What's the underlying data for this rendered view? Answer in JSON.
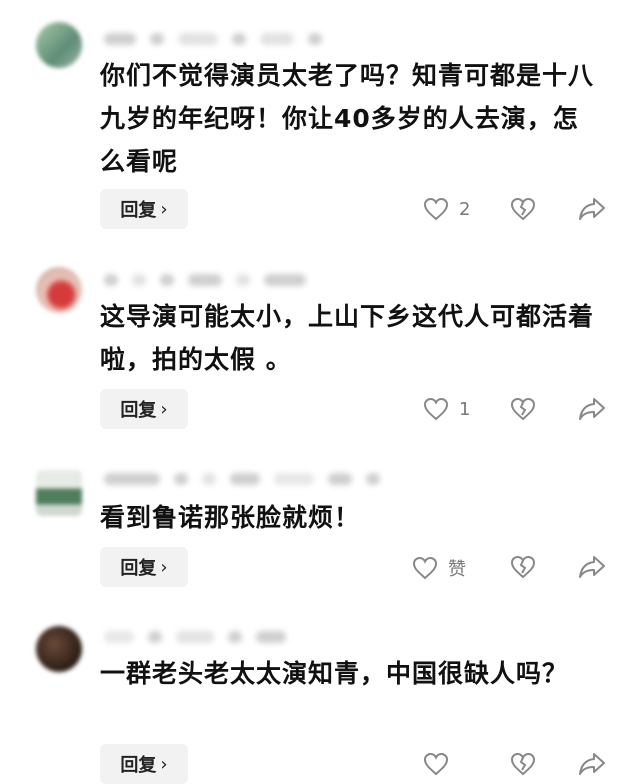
{
  "comments": [
    {
      "text": "你们不觉得演员太老了吗？知青可都是十八九岁的年纪呀！你让40多岁的人去演，怎么看呢",
      "reply_label": "回复",
      "like_count": "2",
      "avatar_color": "#6f9c7e"
    },
    {
      "text": "这导演可能太小，上山下乡这代人可都活着啦，拍的太假 。",
      "reply_label": "回复",
      "like_count": "1",
      "avatar_color": "#c23a3a"
    },
    {
      "text": "看到鲁诺那张脸就烦！",
      "reply_label": "回复",
      "like_count": "赞",
      "avatar_color": "#4d7a5c"
    },
    {
      "text": "一群老头老太太演知青，中国很缺人吗？",
      "reply_label": "回复",
      "like_count": "",
      "avatar_color": "#3b2a22"
    }
  ],
  "icons": {
    "like": "heart-icon",
    "dislike": "broken-heart-icon",
    "share": "share-arrow-icon",
    "reply_chevron": "chevron-right-icon"
  },
  "colors": {
    "text": "#111111",
    "reply_bg": "#f2f2f2",
    "icon": "#888888"
  }
}
